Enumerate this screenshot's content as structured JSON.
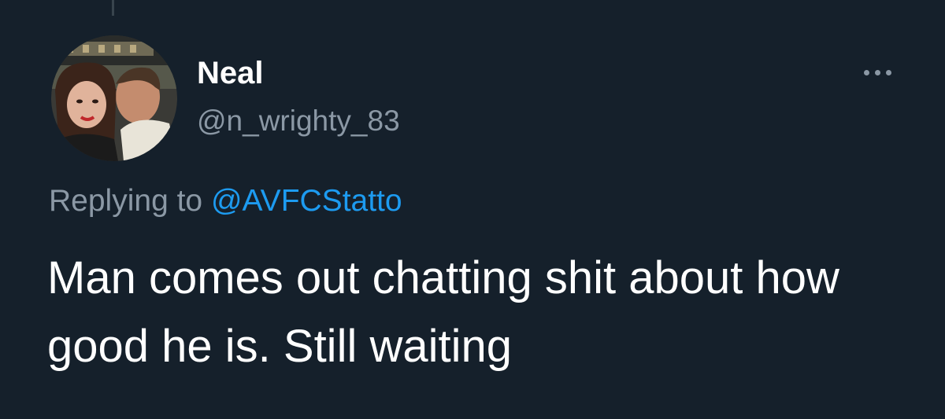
{
  "tweet": {
    "author": {
      "display_name": "Neal",
      "handle": "@n_wrighty_83",
      "avatar_icon": "profile-photo"
    },
    "more_icon": "more-horizontal-icon",
    "replying_to": {
      "prefix": "Replying to",
      "mention": "@AVFCStatto"
    },
    "text": "Man comes out chatting shit about how good he is. Still waiting"
  },
  "colors": {
    "background": "#15202b",
    "primary_text": "#ffffff",
    "secondary_text": "#8b98a5",
    "accent": "#1d9bf0"
  }
}
